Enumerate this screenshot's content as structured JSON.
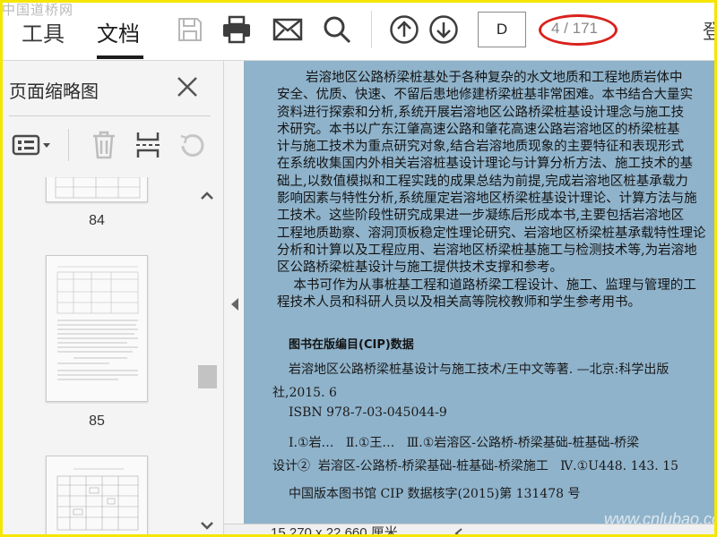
{
  "watermark": "中国道桥网",
  "toolbar": {
    "tabs": [
      {
        "label": "工具"
      },
      {
        "label": "文档"
      }
    ],
    "page_input": "D",
    "page_count": "4 / 171",
    "edge_char": "登",
    "icons": [
      "save-icon",
      "print-icon",
      "mail-icon",
      "search-icon",
      "arrow-up-icon",
      "arrow-down-icon"
    ]
  },
  "sidebar": {
    "title": "页面缩略图",
    "tool_icons": [
      "thumbnail-options-icon",
      "delete-icon",
      "insert-page-icon",
      "rotate-icon"
    ],
    "thumbnails": [
      {
        "page": "84"
      },
      {
        "page": "85"
      },
      {
        "page": ""
      }
    ]
  },
  "document": {
    "paragraph": [
      "岩溶地区公路桥梁桩基处于各种复杂的水文地质和工程地质岩体中",
      "安全、优质、快速、不留后患地修建桥梁桩基非常困难。本书结合大量实",
      "资料进行探索和分析,系统开展岩溶地区公路桥梁桩基设计理念与施工技",
      "术研究。本书以广东江肇高速公路和肇花高速公路岩溶地区的桥梁桩基",
      "计与施工技术为重点研究对象,结合岩溶地质现象的主要特征和表现形式",
      "在系统收集国内外相关岩溶桩基设计理论与计算分析方法、施工技术的基",
      "础上,以数值模拟和工程实践的成果总结为前提,完成岩溶地区桩基承载力",
      "影响因素与特性分析,系统厘定岩溶地区桥梁桩基设计理论、计算方法与施",
      "工技术。这些阶段性研究成果进一步凝练后形成本书,主要包括岩溶地区",
      "工程地质勘察、溶洞顶板稳定性理论研究、岩溶地区桥梁桩基承载特性理论",
      "分析和计算以及工程应用、岩溶地区桥梁桩基施工与检测技术等,为岩溶地",
      "区公路桥梁桩基设计与施工提供技术支撑和参考。",
      "    本书可作为从事桩基工程和道路桥梁工程设计、施工、监理与管理的工",
      "程技术人员和科研人员以及相关高等院校教师和学生参考用书。"
    ],
    "cip_title": "图书在版编目(CIP)数据",
    "cip_lines": [
      "岩溶地区公路桥梁桩基设计与施工技术/王中文等著. —北京:科学出版",
      "社,2015. 6",
      "ISBN 978-7-03-045044-9",
      "Ⅰ.①岩…   Ⅱ.①王…   Ⅲ.①岩溶区-公路桥-桥梁基础-桩基础-桥梁",
      "设计②  岩溶区-公路桥-桥梁基础-桩基础-桥梁施工   Ⅳ.①U448. 143. 15",
      "中国版本图书馆 CIP 数据核字(2015)第 131478 号"
    ],
    "watermark": "www.cnlubao.com"
  },
  "status": {
    "dimensions": "15.270 x 22.660 厘米"
  },
  "colors": {
    "frame": "#f5e600",
    "highlight_ellipse": "#d9221c",
    "page_bg": "#8fb3cb"
  }
}
